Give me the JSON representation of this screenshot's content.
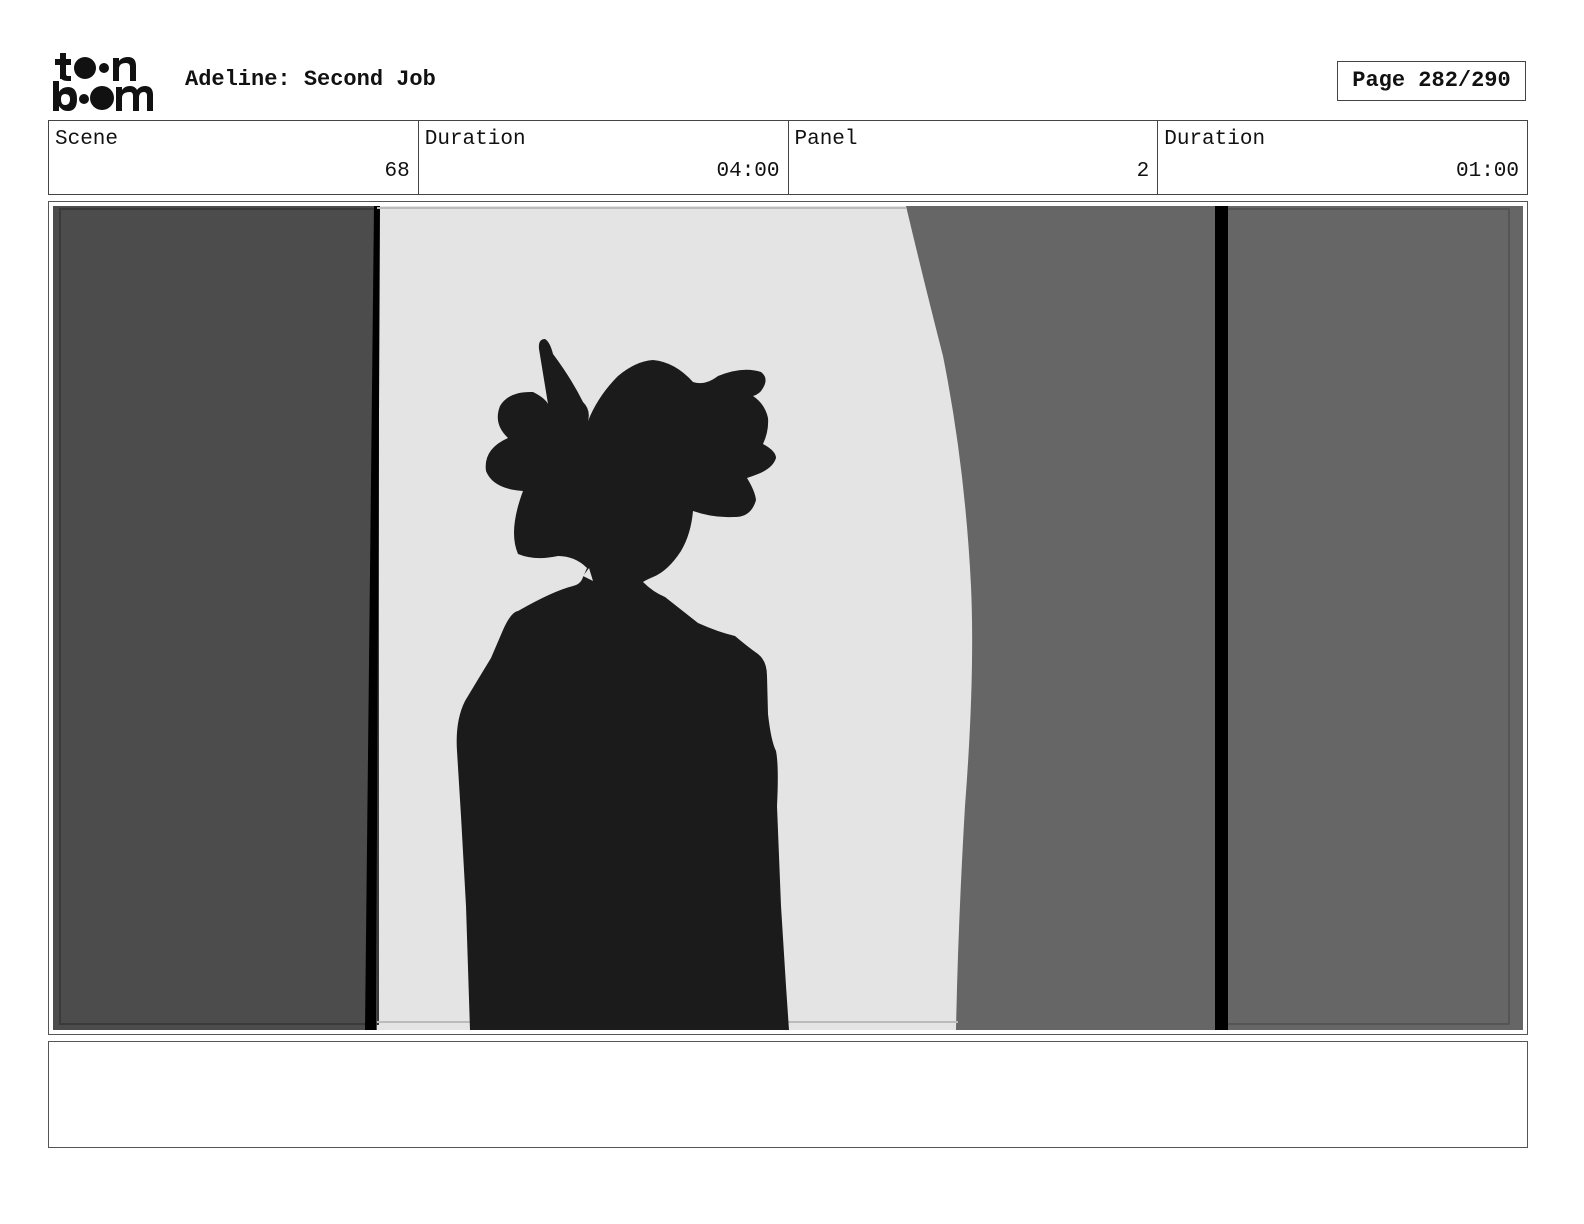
{
  "header": {
    "logo_name": "toon boom",
    "project_title": "Adeline: Second Job",
    "page_label": "Page 282/290"
  },
  "info": {
    "scene_label": "Scene",
    "scene_value": "68",
    "scene_duration_label": "Duration",
    "scene_duration_value": "04:00",
    "panel_label": "Panel",
    "panel_value": "2",
    "panel_duration_label": "Duration",
    "panel_duration_value": "01:00"
  },
  "panel": {
    "colors": {
      "left_wall": "#4c4c4c",
      "doorway": "#e4e4e4",
      "right_wall": "#666666",
      "silhouette": "#1b1b1b",
      "frame_line": "#000000"
    }
  },
  "caption": {
    "text": ""
  }
}
